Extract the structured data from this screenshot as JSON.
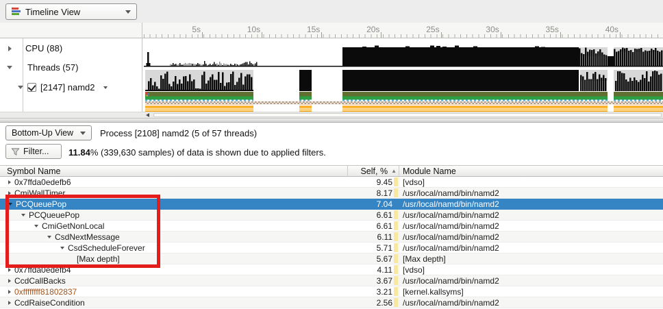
{
  "toolbar": {
    "view_selector": "Timeline View"
  },
  "ruler": {
    "ticks": [
      "5s",
      "10s",
      "15s",
      "20s",
      "25s",
      "30s",
      "35s",
      "40s"
    ]
  },
  "sidebar": {
    "cpu": {
      "label": "CPU (88)",
      "expanded": false
    },
    "threads": {
      "label": "Threads (57)",
      "expanded": true
    },
    "thread_item": {
      "label": "[2147] namd2",
      "checked": true,
      "expanded": true
    }
  },
  "bottom": {
    "view_selector": "Bottom-Up View",
    "process_label": "Process [2108] namd2 (5 of 57 threads)",
    "filter_button": "Filter...",
    "filter_stats_bold": "11.84",
    "filter_stats_rest": "% (339,630 samples) of data is shown due to applied filters."
  },
  "table": {
    "headers": {
      "symbol": "Symbol Name",
      "self": "Self, %",
      "sort_indicator": "▲",
      "module": "Module Name"
    },
    "rows": [
      {
        "symbol": "0x7ffda0edefb6",
        "self": "9.45",
        "module": "[vdso]",
        "indent": 0,
        "expander": "closed"
      },
      {
        "symbol": "CmiWallTimer",
        "self": "8.17",
        "module": "/usr/local/namd/bin/namd2",
        "indent": 0,
        "expander": "closed"
      },
      {
        "symbol": "PCQueuePop",
        "self": "7.04",
        "module": "/usr/local/namd/bin/namd2",
        "indent": 0,
        "expander": "open",
        "selected": true
      },
      {
        "symbol": "PCQueuePop",
        "self": "6.61",
        "module": "/usr/local/namd/bin/namd2",
        "indent": 1,
        "expander": "open"
      },
      {
        "symbol": "CmiGetNonLocal",
        "self": "6.61",
        "module": "/usr/local/namd/bin/namd2",
        "indent": 2,
        "expander": "open"
      },
      {
        "symbol": "CsdNextMessage",
        "self": "6.11",
        "module": "/usr/local/namd/bin/namd2",
        "indent": 3,
        "expander": "open"
      },
      {
        "symbol": "CsdScheduleForever",
        "self": "5.71",
        "module": "/usr/local/namd/bin/namd2",
        "indent": 4,
        "expander": "open"
      },
      {
        "symbol": "[Max depth]",
        "self": "5.67",
        "module": "[Max depth]",
        "indent": 5,
        "expander": "none"
      },
      {
        "symbol": "0x7ffda0edefb4",
        "self": "4.11",
        "module": "[vdso]",
        "indent": 0,
        "expander": "closed"
      },
      {
        "symbol": "CcdCallBacks",
        "self": "3.67",
        "module": "/usr/local/namd/bin/namd2",
        "indent": 0,
        "expander": "closed"
      },
      {
        "symbol": "0xffffffff81802837",
        "self": "3.21",
        "module": "[kernel.kallsyms]",
        "indent": 0,
        "expander": "closed",
        "kernel": true
      },
      {
        "symbol": "CcdRaiseCondition",
        "self": "2.56",
        "module": "/usr/local/namd/bin/namd2",
        "indent": 0,
        "expander": "closed"
      }
    ]
  },
  "colors": {
    "selection": "#3584c4",
    "annotation": "#e51c1c",
    "kernel-symbol": "#a3541c",
    "cost-bar": "#f9e7a0",
    "band-olive": "#5f7030",
    "band-green": "#2e9e44",
    "band-blue": "#5aa7d8",
    "band-tan": "#b09a86",
    "band-tan-bg": "#ece4db",
    "band-peach": "#fcdcb2",
    "band-orange": "#f9a602",
    "hist-bg": "#d8d8d8",
    "hist-bar": "#0b0b0b"
  }
}
